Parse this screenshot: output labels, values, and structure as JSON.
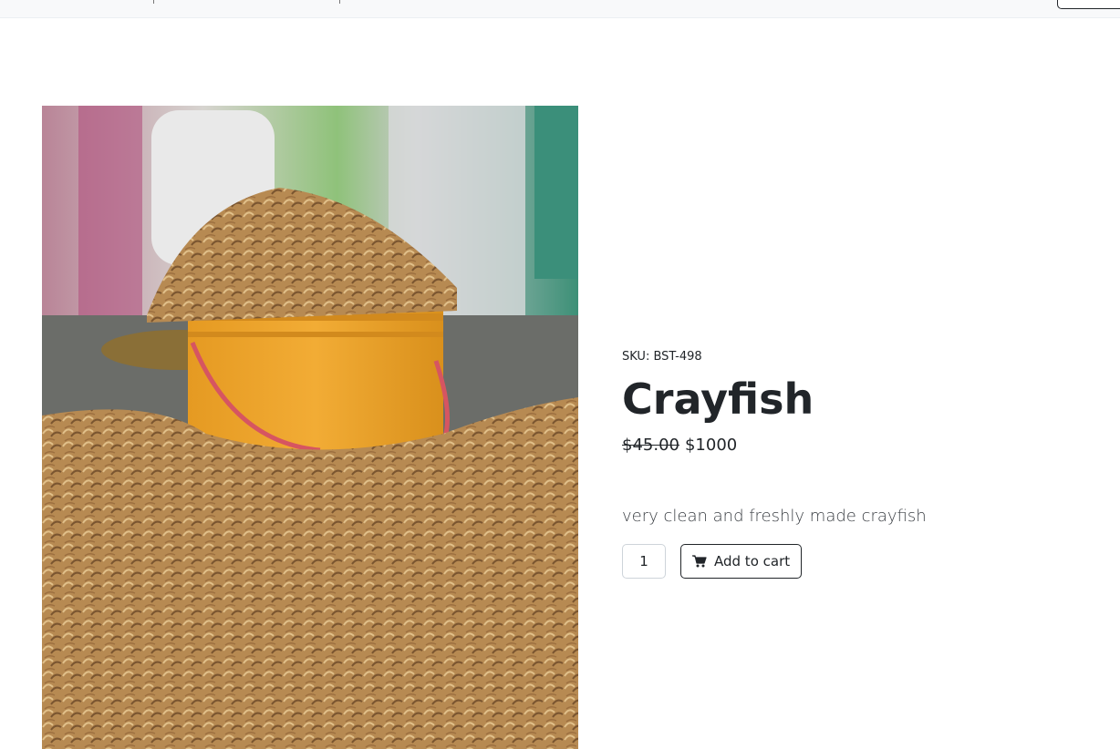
{
  "product": {
    "sku": "SKU: BST-498",
    "name": "Crayfish",
    "old_price": "$45.00",
    "price": "$1000",
    "description": "very clean and freshly made crayfish",
    "quantity": "1",
    "add_to_cart_label": "Add to cart",
    "image_icon": "product-photo"
  },
  "cart_icon": "cart-icon",
  "colors": {
    "text": "#212529",
    "border": "#212529",
    "topbar": "#f8f9fa"
  }
}
